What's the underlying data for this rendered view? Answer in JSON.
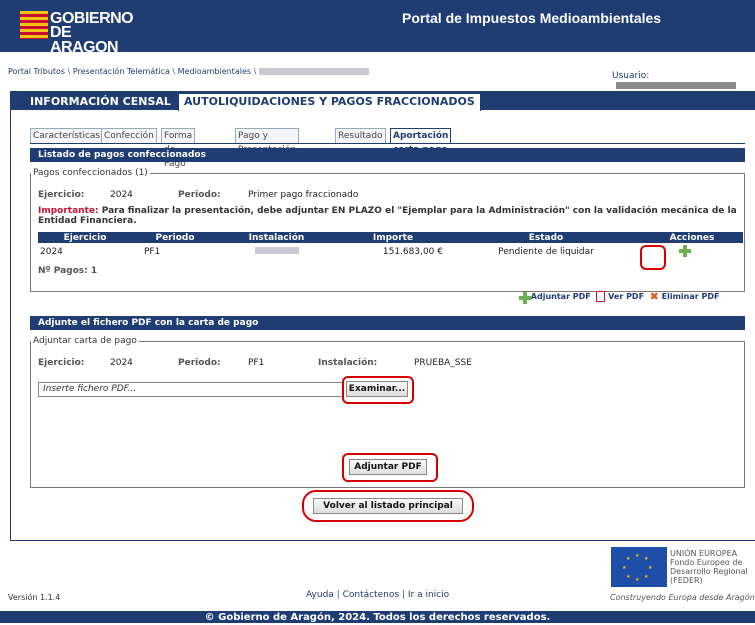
{
  "header": {
    "logo_line1": "GOBIERNO",
    "logo_line2": "DE ARAGON",
    "title": "Portal de Impuestos Medioambientales"
  },
  "breadcrumb": {
    "items": [
      "Portal Tributos",
      "Presentación Telemática",
      "Medioambientales"
    ],
    "sep": " \\ "
  },
  "user": {
    "label": "Usuario:"
  },
  "main_tabs": [
    "INFORMACIÓN CENSAL",
    "AUTOLIQUIDACIONES Y PAGOS FRACCIONADOS"
  ],
  "sub_tabs": [
    "Características",
    "Confección",
    "Forma de Pago",
    "Pago y Presentación",
    "Resultado",
    "Aportación carta pago"
  ],
  "listado": {
    "header": "Listado de pagos confeccionados",
    "legend": "Pagos confeccionados (1)",
    "ejercicio_label": "Ejercicio:",
    "ejercicio": "2024",
    "periodo_label": "Periodo:",
    "periodo": "Primer pago fraccionado",
    "importante_label": "Importante:",
    "importante_text": " Para finalizar la presentación, debe adjuntar EN PLAZO el \"Ejemplar para la Administración\" con la validación mecánica de la Entidad Financiera.",
    "columns": [
      "Ejercicio",
      "Periodo",
      "Instalación",
      "Importe",
      "Estado",
      "Acciones"
    ],
    "row": {
      "ejercicio": "2024",
      "periodo": "PF1",
      "importe": "151.683,00 €",
      "estado": "Pendiente de liquidar"
    },
    "npagos": "Nº Pagos: 1",
    "action_adjuntar": "Adjuntar PDF",
    "action_ver": "Ver PDF",
    "action_eliminar": "Eliminar PDF"
  },
  "adjunte": {
    "header": "Adjunte el fichero PDF con la carta de pago",
    "legend": "Adjuntar carta de pago",
    "ejercicio_label": "Ejercicio:",
    "ejercicio": "2024",
    "periodo_label": "Periodo:",
    "periodo": "PF1",
    "instalacion_label": "Instalación:",
    "instalacion": "PRUEBA_SSE",
    "file_placeholder": "Inserte fichero PDF...",
    "examinar": "Examinar...",
    "adjuntar": "Adjuntar PDF"
  },
  "volver": "Volver al listado principal",
  "footer": {
    "version": "Versión 1.1.4",
    "ayuda": "Ayuda",
    "contactenos": "Contáctenos",
    "inicio": "Ir a inicio",
    "eu_line1": "UNIÓN EUROPEA",
    "eu_line2": "Fondo Europeo de",
    "eu_line3": "Desarrollo Regional",
    "eu_line4": "(FEDER)",
    "eu_slogan": "Construyendo Europa desde Aragón",
    "copyright": "© Gobierno de Aragón, 2024. Todos los derechos reservados."
  },
  "colors": {
    "primary": "#1f3d73",
    "highlight": "#d40000",
    "important": "#c8102e",
    "add_green": "#6ab04c"
  }
}
